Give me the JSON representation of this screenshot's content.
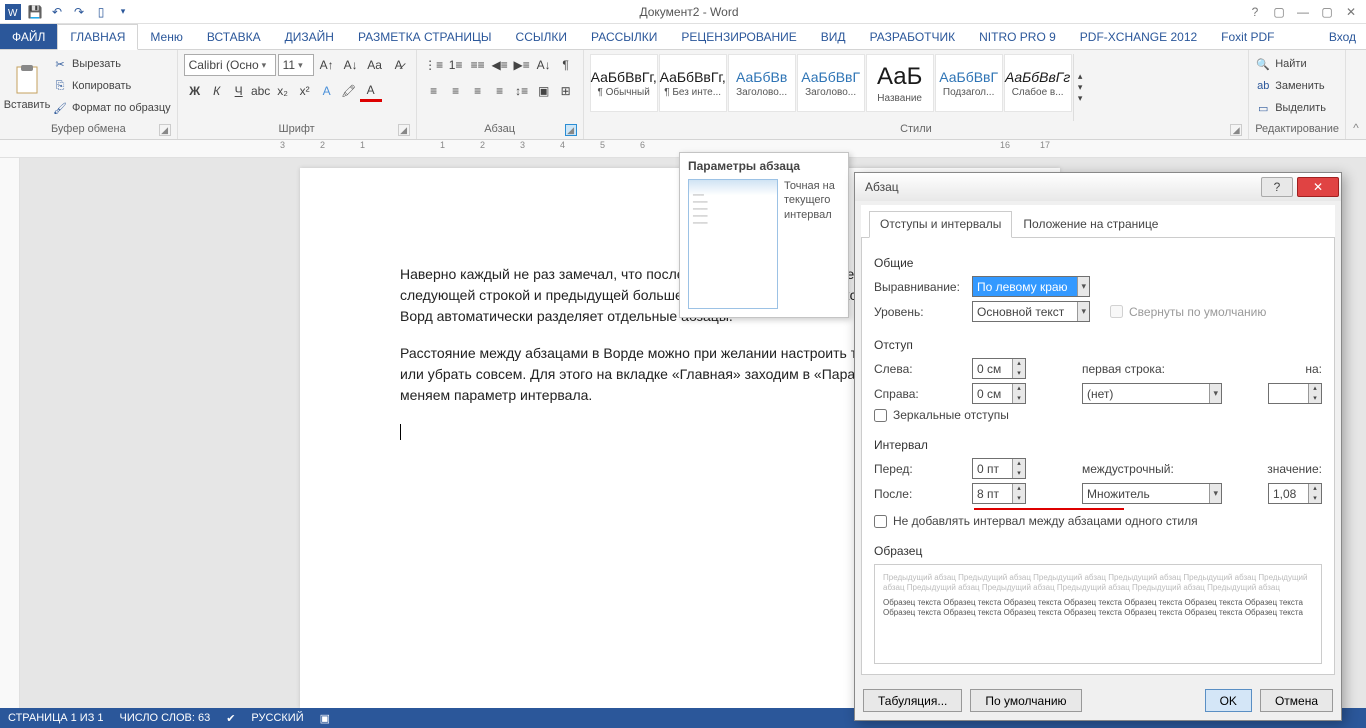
{
  "title": "Документ2 - Word",
  "tabs": {
    "file": "ФАЙЛ",
    "list": [
      "ГЛАВНАЯ",
      "Меню",
      "ВСТАВКА",
      "ДИЗАЙН",
      "РАЗМЕТКА СТРАНИЦЫ",
      "ССЫЛКИ",
      "РАССЫЛКИ",
      "РЕЦЕНЗИРОВАНИЕ",
      "ВИД",
      "РАЗРАБОТЧИК",
      "NITRO PRO 9",
      "PDF-XCHANGE 2012",
      "Foxit PDF"
    ],
    "login": "Вход"
  },
  "ribbon": {
    "clipboard": {
      "paste": "Вставить",
      "cut": "Вырезать",
      "copy": "Копировать",
      "format": "Формат по образцу",
      "label": "Буфер обмена"
    },
    "font": {
      "name": "Calibri (Осно",
      "size": "11",
      "label": "Шрифт"
    },
    "para": {
      "label": "Абзац"
    },
    "styles": {
      "label": "Стили",
      "items": [
        {
          "sample": "АаБбВвГг,",
          "name": "¶ Обычный"
        },
        {
          "sample": "АаБбВвГг,",
          "name": "¶ Без инте..."
        },
        {
          "sample": "АаБбВв",
          "name": "Заголово...",
          "blue": true
        },
        {
          "sample": "АаБбВвГ",
          "name": "Заголово...",
          "blue": true
        },
        {
          "sample": "АаБ",
          "name": "Название"
        },
        {
          "sample": "АаБбВвГ",
          "name": "Подзагол...",
          "blue": true
        },
        {
          "sample": "АаБбВвГг",
          "name": "Слабое в..."
        }
      ]
    },
    "editing": {
      "find": "Найти",
      "replace": "Заменить",
      "select": "Выделить",
      "label": "Редактирование"
    }
  },
  "tooltip": {
    "title": "Параметры абзаца",
    "text": "Точная на\nтекущего\nинтервал"
  },
  "doc": {
    "p1": "Наверно каждый не раз замечал, что после нажатия на клавишу Enter расстояние между следующей строкой и предыдущей больше, чем между строками текста. Таким образом Ворд автоматически разделяет отдельные абзацы.",
    "p2": "Расстояние между абзацами в Ворде можно при желании настроить так, как вам удобно, или убрать совсем. Для этого на вкладке «Главная» заходим в «Параметры абзаца» и меняем параметр интервала."
  },
  "dialog": {
    "title": "Абзац",
    "tabs": [
      "Отступы и интервалы",
      "Положение на странице"
    ],
    "section_general": "Общие",
    "align_label": "Выравнивание:",
    "align_value": "По левому краю",
    "level_label": "Уровень:",
    "level_value": "Основной текст",
    "collapse_label": "Свернуты по умолчанию",
    "section_indent": "Отступ",
    "left_label": "Слева:",
    "left_value": "0 см",
    "right_label": "Справа:",
    "right_value": "0 см",
    "firstline_label": "первая строка:",
    "firstline_value": "(нет)",
    "by_label": "на:",
    "mirror_label": "Зеркальные отступы",
    "section_spacing": "Интервал",
    "before_label": "Перед:",
    "before_value": "0 пт",
    "after_label": "После:",
    "after_value": "8 пт",
    "linespace_label": "междустрочный:",
    "linespace_value": "Множитель",
    "at_label": "значение:",
    "at_value": "1,08",
    "nosame_label": "Не добавлять интервал между абзацами одного стиля",
    "section_preview": "Образец",
    "preview_prev": "Предыдущий абзац Предыдущий абзац Предыдущий абзац Предыдущий абзац Предыдущий абзац Предыдущий абзац Предыдущий абзац Предыдущий абзац Предыдущий абзац Предыдущий абзац Предыдущий абзац",
    "preview_sample": "Образец текста Образец текста Образец текста Образец текста Образец текста Образец текста Образец текста Образец текста Образец текста Образец текста Образец текста Образец текста Образец текста Образец текста",
    "btn_tabs": "Табуляция...",
    "btn_default": "По умолчанию",
    "btn_ok": "OK",
    "btn_cancel": "Отмена"
  },
  "status": {
    "page": "СТРАНИЦА 1 ИЗ 1",
    "words": "ЧИСЛО СЛОВ: 63",
    "lang": "РУССКИЙ"
  }
}
